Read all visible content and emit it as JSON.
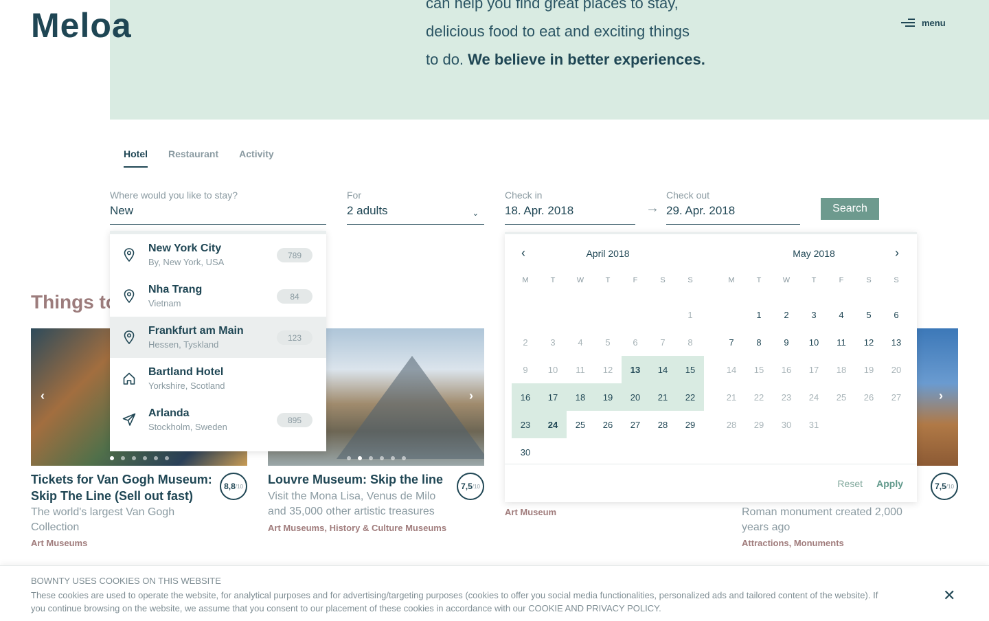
{
  "brand": {
    "logo": "Meloa"
  },
  "hero": {
    "line1": "can help you find great places to stay,",
    "line2": "delicious food to eat and exciting things",
    "line3": "to do.",
    "emphasis": "We believe in better experiences."
  },
  "menu": {
    "label": "menu",
    "icon": "hamburger-icon"
  },
  "tabs": [
    {
      "label": "Hotel",
      "active": true
    },
    {
      "label": "Restaurant",
      "active": false
    },
    {
      "label": "Activity",
      "active": false
    }
  ],
  "search": {
    "where_label": "Where would you like to stay?",
    "where_value": "New",
    "for_label": "For",
    "for_value": "2 adults",
    "checkin_label": "Check in",
    "checkin_value": "18. Apr. 2018",
    "checkout_label": "Check out",
    "checkout_value": "29. Apr. 2018",
    "button": "Search"
  },
  "suggestions": [
    {
      "name": "New York City",
      "sub": "By, New York, USA",
      "count": "789",
      "icon": "map-pin-icon"
    },
    {
      "name": "Nha Trang",
      "sub": "Vietnam",
      "count": "84",
      "icon": "map-pin-icon"
    },
    {
      "name": "Frankfurt am Main",
      "sub": "Hessen, Tyskland",
      "count": "123",
      "icon": "map-pin-icon",
      "highlighted": true
    },
    {
      "name": "Bartland Hotel",
      "sub": "Yorkshire, Scotland",
      "count": "",
      "icon": "house-icon"
    },
    {
      "name": "Arlanda",
      "sub": "Stockholm, Sweden",
      "count": "895",
      "icon": "plane-icon"
    }
  ],
  "section": {
    "title": "Things to"
  },
  "cards": [
    {
      "title_line1": "Tickets for Van Gogh Museum:",
      "title_line2": "Skip The Line (Sell out fast)",
      "desc_line1": "The world's largest Van Gogh",
      "desc_line2": "Collection",
      "category": "Art Museums",
      "rating": "8,8",
      "rating_scale": "/10"
    },
    {
      "title_line1": "Louvre Museum: Skip the line",
      "desc_line1": "Visit the Mona Lisa, Venus de Milo",
      "desc_line2": "and 35,000 other artistic treasures",
      "category": "Art Museums, History & Culture Museums",
      "rating": "7,5",
      "rating_scale": "/10"
    },
    {
      "category": "Art Museum"
    },
    {
      "desc_line1": "Roman monument created 2,000",
      "desc_line2": "years ago",
      "category": "Attractions, Monuments",
      "rating": "7,5",
      "rating_scale": "/10"
    }
  ],
  "calendar": {
    "weekdays": [
      "M",
      "T",
      "W",
      "T",
      "F",
      "S",
      "S"
    ],
    "months": [
      {
        "title": "April 2018",
        "offset": 6,
        "days": 30,
        "available_from": 13,
        "range_start": 13,
        "range_end": 24
      },
      {
        "title": "May 2018",
        "offset": 1,
        "days": 31,
        "available_to": 13
      }
    ],
    "reset": "Reset",
    "apply": "Apply"
  },
  "cookie": {
    "title": "BOWNTY USES COOKIES ON THIS WEBSITE",
    "text": "These cookies are used to operate the website, for analytical purposes and for advertising/targeting purposes (cookies to offer you social media functionalities, personalized ads and tailored content of the website). If you continue browsing on the website, we assume that you consent to our placement of these cookies in accordance with our COOKIE AND PRIVACY POLICY."
  },
  "colors": {
    "primary": "#1f4654",
    "hero_bg": "#d9ebe2",
    "accent": "#6d9a8e",
    "category": "#a07c7c",
    "muted": "#8a9aa1"
  }
}
